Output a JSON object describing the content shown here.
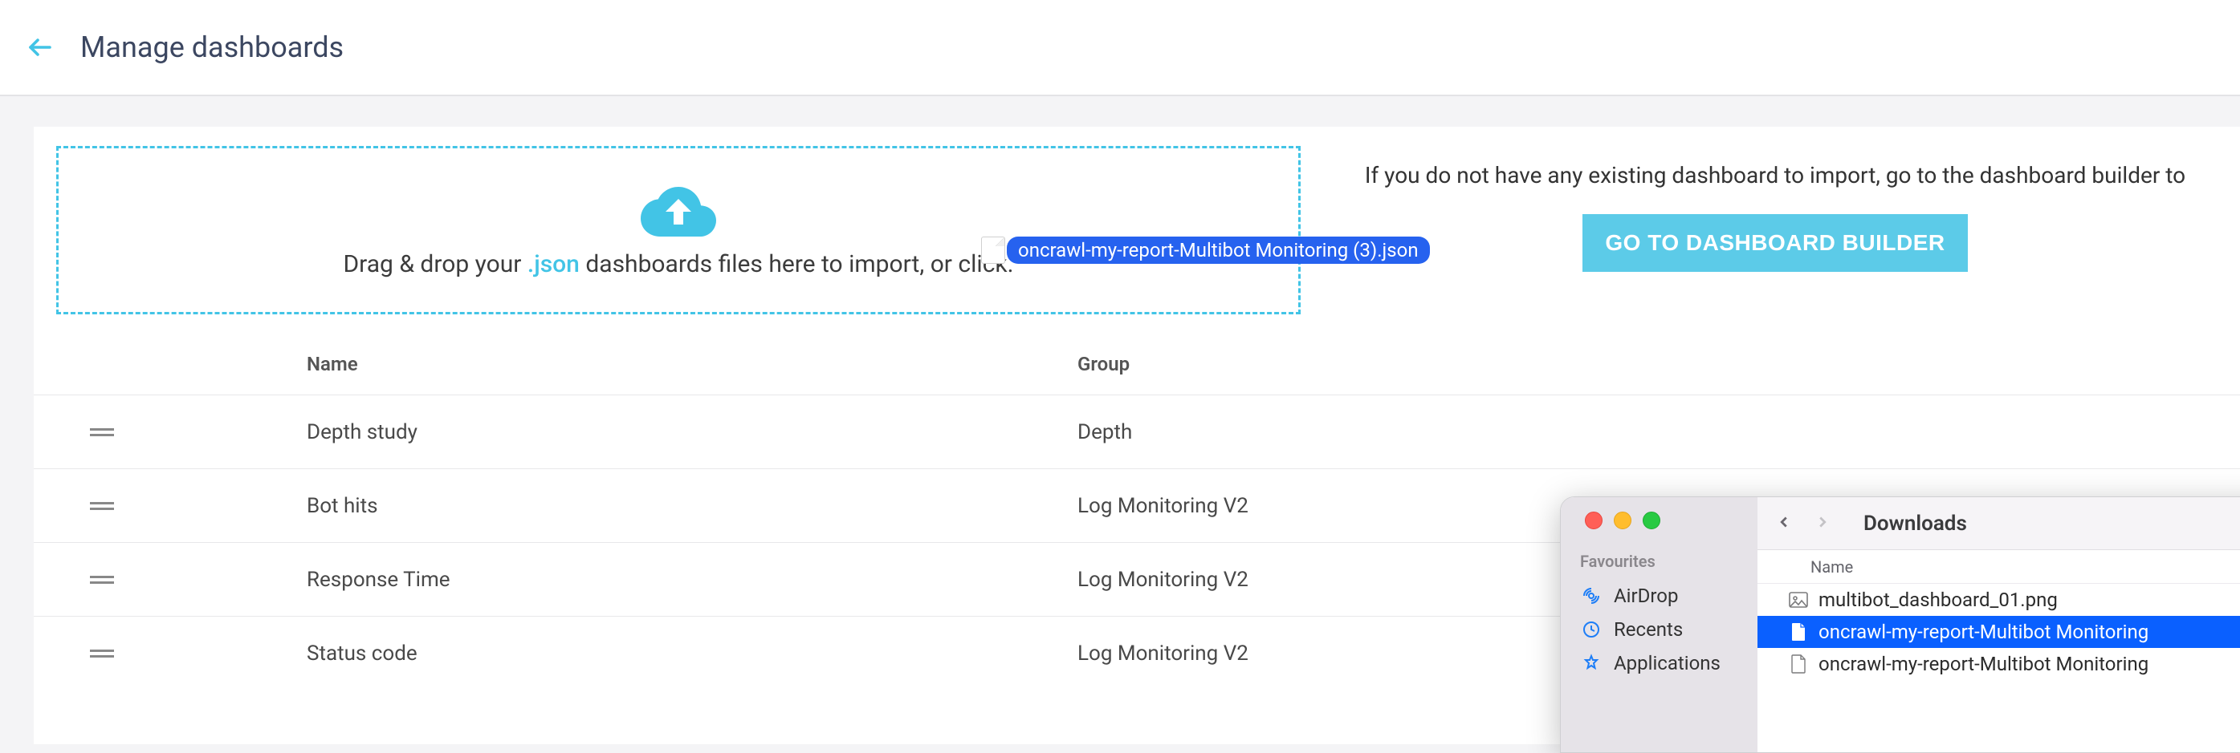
{
  "header": {
    "title": "Manage dashboards"
  },
  "dropzone": {
    "text_pre": "Drag & drop your ",
    "text_ext": ".json",
    "text_post": " dashboards files here to import, or click."
  },
  "no_dash_text": "If you do not have any existing dashboard to import, go to the dashboard builder to",
  "builder_btn": "GO TO DASHBOARD BUILDER",
  "table": {
    "headers": {
      "name": "Name",
      "group": "Group"
    },
    "rows": [
      {
        "name": "Depth study",
        "group": "Depth"
      },
      {
        "name": "Bot hits",
        "group": "Log Monitoring V2"
      },
      {
        "name": "Response Time",
        "group": "Log Monitoring V2"
      },
      {
        "name": "Status code",
        "group": "Log Monitoring V2"
      }
    ]
  },
  "drag_file_label": "oncrawl-my-report-Multibot Monitoring (3).json",
  "finder": {
    "title": "Downloads",
    "sidebar_title": "Favourites",
    "sidebar_items": [
      {
        "label": "AirDrop"
      },
      {
        "label": "Recents"
      },
      {
        "label": "Applications"
      }
    ],
    "list_header": "Name",
    "files": [
      {
        "name": "multibot_dashboard_01.png",
        "type": "img",
        "selected": false
      },
      {
        "name": "oncrawl-my-report-Multibot Monitoring",
        "type": "doc",
        "selected": true
      },
      {
        "name": "oncrawl-my-report-Multibot Monitoring",
        "type": "doc",
        "selected": false
      }
    ]
  }
}
